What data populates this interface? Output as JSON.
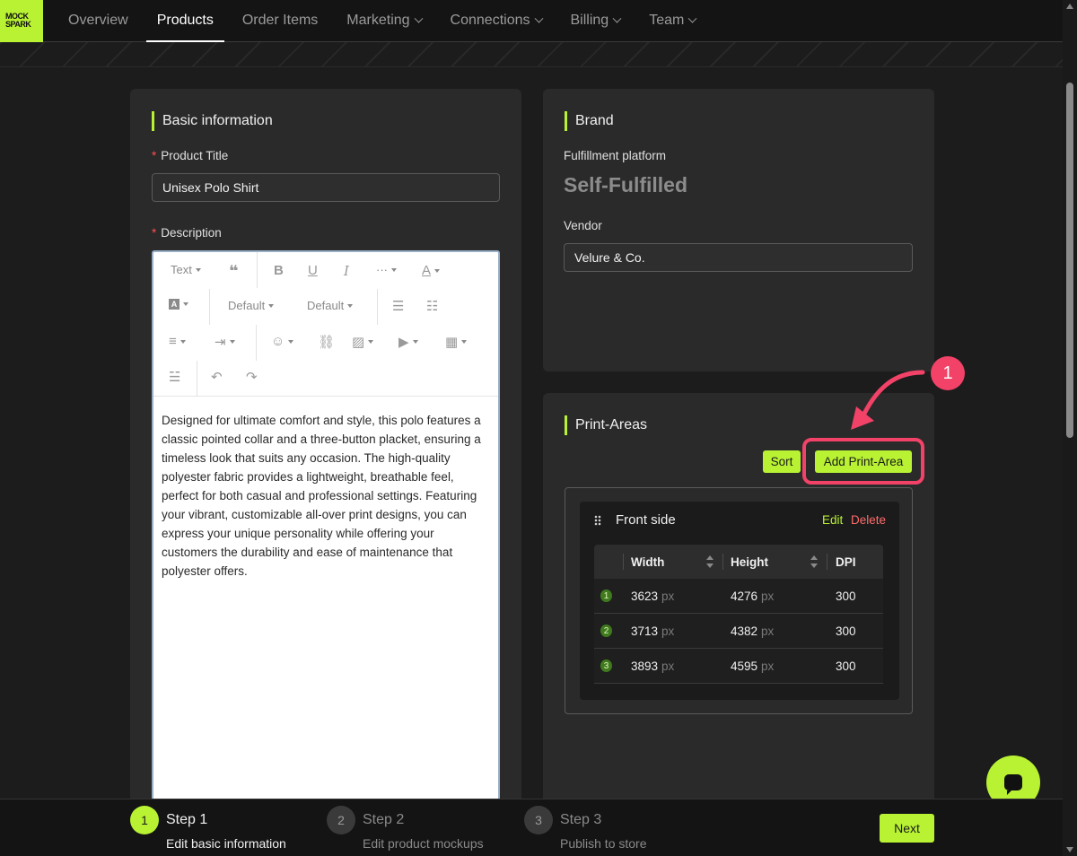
{
  "logo": {
    "line1": "MOCK",
    "line2": "SPARK"
  },
  "nav": {
    "items": [
      {
        "label": "Overview",
        "dropdown": false
      },
      {
        "label": "Products",
        "dropdown": false
      },
      {
        "label": "Order Items",
        "dropdown": false
      },
      {
        "label": "Marketing",
        "dropdown": true
      },
      {
        "label": "Connections",
        "dropdown": true
      },
      {
        "label": "Billing",
        "dropdown": true
      },
      {
        "label": "Team",
        "dropdown": true
      }
    ],
    "active": "Products"
  },
  "basic": {
    "title": "Basic information",
    "product_title_label": "Product Title",
    "product_title_value": "Unisex Polo Shirt",
    "description_label": "Description",
    "toolbar": {
      "text_label": "Text",
      "default_font": "Default",
      "default_size": "Default",
      "more": "···"
    },
    "description_text": "Designed for ultimate comfort and style, this polo features a classic pointed collar and a three-button placket, ensuring a timeless look that suits any occasion. The high-quality polyester fabric provides a lightweight, breathable feel, perfect for both casual and professional settings. Featuring your vibrant, customizable all-over print designs, you can express your unique personality while offering your customers the durability and ease of maintenance that polyester offers."
  },
  "brand": {
    "title": "Brand",
    "platform_label": "Fulfillment platform",
    "platform_value": "Self-Fulfilled",
    "vendor_label": "Vendor",
    "vendor_value": "Velure & Co."
  },
  "print_areas": {
    "title": "Print-Areas",
    "sort_label": "Sort",
    "add_label": "Add Print-Area",
    "area": {
      "name": "Front side",
      "edit_label": "Edit",
      "delete_label": "Delete",
      "columns": [
        "Width",
        "Height",
        "DPI"
      ],
      "rows": [
        {
          "index": "1",
          "width": "3623",
          "height": "4276",
          "dpi": "300"
        },
        {
          "index": "2",
          "width": "3713",
          "height": "4382",
          "dpi": "300"
        },
        {
          "index": "3",
          "width": "3893",
          "height": "4595",
          "dpi": "300"
        }
      ],
      "unit": "px"
    }
  },
  "annotation": {
    "number": "1",
    "color": "#f24268"
  },
  "steps": [
    {
      "number": "1",
      "title": "Step 1",
      "desc": "Edit basic information",
      "active": true
    },
    {
      "number": "2",
      "title": "Step 2",
      "desc": "Edit product mockups",
      "active": false
    },
    {
      "number": "3",
      "title": "Step 3",
      "desc": "Publish to store",
      "active": false
    }
  ],
  "next_label": "Next",
  "colors": {
    "accent": "#b8f233",
    "danger": "#ff6b6b",
    "bg": "#1c1c1c",
    "card": "#2a2a2a"
  }
}
